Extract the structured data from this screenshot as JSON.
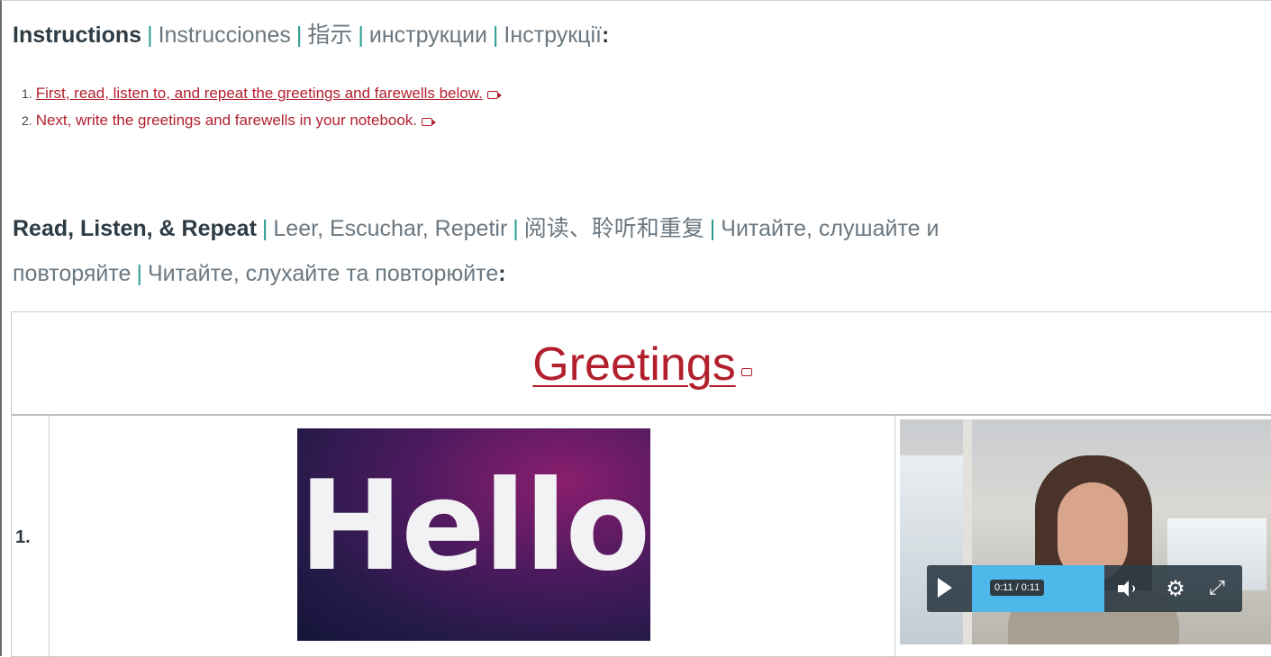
{
  "instructions_heading": {
    "main": "Instructions",
    "alternates": [
      "Instrucciones",
      "指示",
      "инструкции",
      "Інструкції"
    ],
    "colon": ":"
  },
  "steps": [
    {
      "number": "1.",
      "text": "First, read, listen to, and repeat the greetings and farewells below."
    },
    {
      "number": "2.",
      "text": "Next, write the greetings and farewells in your notebook."
    }
  ],
  "read_heading": {
    "main": "Read, Listen, & Repeat",
    "alternates_line1": [
      "Leer, Escuchar, Repetir",
      "阅读、聆听和重复",
      "Читайте, слушайте и"
    ],
    "alternates_line2": [
      "повторяйте",
      "Читайте, слухайте та повторюйте"
    ],
    "colon": ":"
  },
  "table": {
    "title": "Greetings",
    "rows": [
      {
        "number": "1.",
        "image_text": "Hello",
        "video": {
          "time": "0:11 / 0:11"
        }
      }
    ]
  },
  "icons": {
    "external_link": "external-link-icon",
    "play": "play-icon",
    "volume": "volume-icon",
    "settings": "gear-icon",
    "fullscreen": "fullscreen-icon"
  },
  "colors": {
    "link_red": "#b21f2d",
    "separator_teal": "#2d9c8f",
    "heading_dark": "#2d3b45",
    "alt_gray": "#6b7780",
    "progress_blue": "#4fb8ea"
  }
}
